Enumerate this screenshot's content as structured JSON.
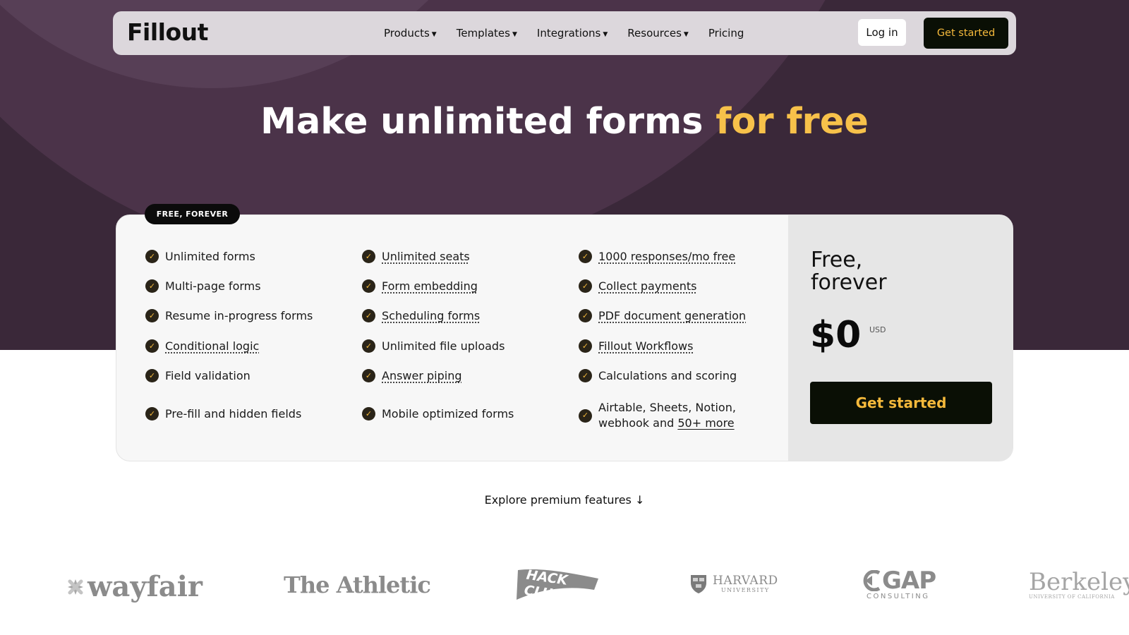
{
  "nav": {
    "logo": "Fillout",
    "items": [
      {
        "label": "Products",
        "dropdown": true
      },
      {
        "label": "Templates",
        "dropdown": true
      },
      {
        "label": "Integrations",
        "dropdown": true
      },
      {
        "label": "Resources",
        "dropdown": true
      },
      {
        "label": "Pricing",
        "dropdown": false
      }
    ],
    "login_label": "Log in",
    "cta_label": "Get started"
  },
  "hero": {
    "title_main": "Make unlimited forms ",
    "title_accent": "for free"
  },
  "plan": {
    "badge": "FREE, FOREVER",
    "features": [
      [
        {
          "text": "Unlimited forms",
          "tooltip": false
        },
        {
          "text": "Multi-page forms",
          "tooltip": false
        },
        {
          "text": "Resume in-progress forms",
          "tooltip": false
        },
        {
          "text": "Conditional logic",
          "tooltip": true
        },
        {
          "text": "Field validation",
          "tooltip": false
        },
        {
          "text": "Pre-fill and hidden fields",
          "tooltip": false
        }
      ],
      [
        {
          "text": "Unlimited seats",
          "tooltip": true
        },
        {
          "text": "Form embedding",
          "tooltip": true
        },
        {
          "text": "Scheduling forms",
          "tooltip": true
        },
        {
          "text": "Unlimited file uploads",
          "tooltip": false
        },
        {
          "text": "Answer piping",
          "tooltip": true
        },
        {
          "text": "Mobile optimized forms",
          "tooltip": false
        }
      ],
      [
        {
          "text": "1000 responses/mo free",
          "tooltip": true
        },
        {
          "text": "Collect payments",
          "tooltip": true
        },
        {
          "text": "PDF document generation",
          "tooltip": true
        },
        {
          "text": "Fillout Workflows",
          "tooltip": true
        },
        {
          "text": "Calculations and scoring",
          "tooltip": false
        }
      ]
    ],
    "integrations_line1": "Airtable, Sheets, Notion,",
    "integrations_line2": "webhook and ",
    "integrations_link": "50+ more",
    "price_title_line1": "Free,",
    "price_title_line2": "forever",
    "price": "$0",
    "currency": "USD",
    "cta_label": "Get started"
  },
  "explore": {
    "label": "Explore premium features ↓"
  },
  "logos": {
    "wayfair": "wayfair",
    "athletic": "The Athletic",
    "hackclub": "HACK CLUB",
    "harvard_name": "HARVARD",
    "harvard_sub": "UNIVERSITY",
    "gap_name": "GAP",
    "gap_sub": "CONSULTING",
    "berkeley_name": "Berkeley",
    "berkeley_sub": "UNIVERSITY OF CALIFORNIA"
  },
  "colors": {
    "hero_bg": "#3a2839",
    "accent": "#f7c14a",
    "cta_bg": "#0a0f05",
    "cta_text": "#f5b93b"
  }
}
